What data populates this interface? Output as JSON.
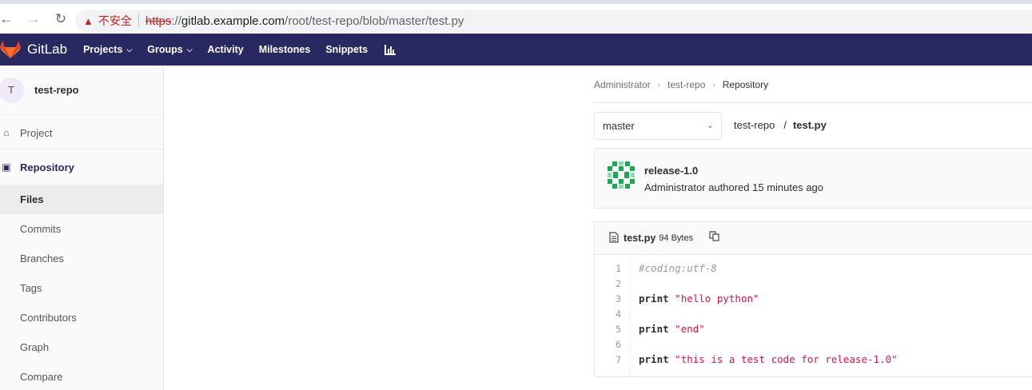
{
  "browser": {
    "insecure_label": "不安全",
    "url_scheme": "https",
    "url_sep": "://",
    "url_host": "gitlab.example.com",
    "url_path": "/root/test-repo/blob/master/test.py"
  },
  "header": {
    "brand": "GitLab",
    "nav": [
      {
        "label": "Projects"
      },
      {
        "label": "Groups"
      },
      {
        "label": "Activity"
      },
      {
        "label": "Milestones"
      },
      {
        "label": "Snippets"
      }
    ],
    "bg_color": "#292961",
    "logo_color": "#e24329"
  },
  "sidebar": {
    "avatar_letter": "T",
    "project_name": "test-repo",
    "items": [
      {
        "label": "Project",
        "icon": "home-icon"
      },
      {
        "label": "Repository",
        "icon": "repository-icon"
      }
    ],
    "sub_items": [
      {
        "label": "Files",
        "active": true
      },
      {
        "label": "Commits"
      },
      {
        "label": "Branches"
      },
      {
        "label": "Tags"
      },
      {
        "label": "Contributors"
      },
      {
        "label": "Graph"
      },
      {
        "label": "Compare"
      }
    ]
  },
  "breadcrumb": [
    "Administrator",
    "test-repo",
    "Repository"
  ],
  "branch": {
    "selected": "master"
  },
  "path": {
    "root": "test-repo",
    "separator": "/",
    "file": "test.py"
  },
  "commit": {
    "title": "release-1.0",
    "meta": "Administrator authored 15 minutes ago",
    "identicon_color": "#1aaa55"
  },
  "file": {
    "name": "test.py",
    "size": "94 Bytes",
    "lines": [
      {
        "n": "1",
        "tokens": [
          {
            "t": "comment",
            "v": "#coding:utf-8"
          }
        ]
      },
      {
        "n": "2",
        "tokens": []
      },
      {
        "n": "3",
        "tokens": [
          {
            "t": "kw",
            "v": "print"
          },
          {
            "t": "plain",
            "v": " "
          },
          {
            "t": "str",
            "v": "\"hello python\""
          }
        ]
      },
      {
        "n": "4",
        "tokens": []
      },
      {
        "n": "5",
        "tokens": [
          {
            "t": "kw",
            "v": "print"
          },
          {
            "t": "plain",
            "v": " "
          },
          {
            "t": "str",
            "v": "\"end\""
          }
        ]
      },
      {
        "n": "6",
        "tokens": []
      },
      {
        "n": "7",
        "tokens": [
          {
            "t": "kw",
            "v": "print"
          },
          {
            "t": "plain",
            "v": " "
          },
          {
            "t": "str",
            "v": "\"this is a test code for release-1.0\""
          }
        ]
      }
    ]
  }
}
